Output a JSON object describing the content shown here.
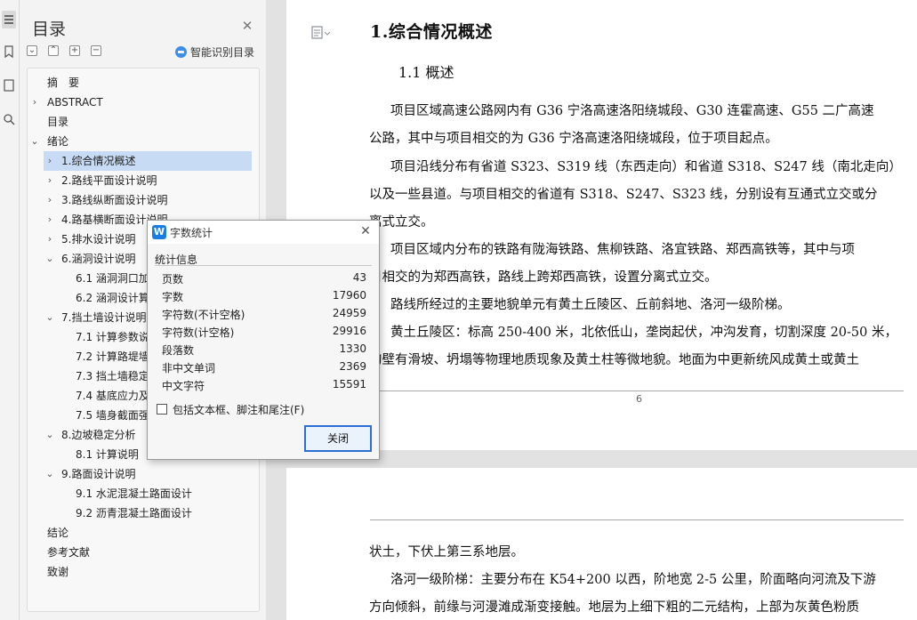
{
  "nav": {
    "title": "目录",
    "smart_label": "智能识别目录",
    "items": [
      {
        "label": "摘　要",
        "caret": ""
      },
      {
        "label": "ABSTRACT",
        "caret": "›"
      },
      {
        "label": "目录",
        "caret": ""
      },
      {
        "label": "绪论",
        "caret": "⌄"
      },
      {
        "label": "1.综合情况概述",
        "caret": "›"
      },
      {
        "label": "2.路线平面设计说明",
        "caret": "›"
      },
      {
        "label": "3.路线纵断面设计说明",
        "caret": "›"
      },
      {
        "label": "4.路基横断面设计说明",
        "caret": "›"
      },
      {
        "label": "5.排水设计说明",
        "caret": "›"
      },
      {
        "label": "6.涵洞设计说明",
        "caret": "⌄"
      },
      {
        "label": "6.1  涵洞洞口加",
        "caret": ""
      },
      {
        "label": "6.2  涵洞设计算",
        "caret": ""
      },
      {
        "label": "7.挡土墙设计说明",
        "caret": "⌄"
      },
      {
        "label": "7.1  计算参数说",
        "caret": ""
      },
      {
        "label": "7.2  计算路堤墙",
        "caret": ""
      },
      {
        "label": "7.3  挡土墙稳定",
        "caret": ""
      },
      {
        "label": "7.4  基底应力及",
        "caret": ""
      },
      {
        "label": "7.5  墙身截面强",
        "caret": ""
      },
      {
        "label": "8.边坡稳定分析",
        "caret": "⌄"
      },
      {
        "label": "8.1 计算说明",
        "caret": ""
      },
      {
        "label": "9.路面设计说明",
        "caret": "⌄"
      },
      {
        "label": "9.1  水泥混凝土路面设计",
        "caret": ""
      },
      {
        "label": "9.2  沥青混凝土路面设计",
        "caret": ""
      },
      {
        "label": "结论",
        "caret": ""
      },
      {
        "label": "参考文献",
        "caret": ""
      },
      {
        "label": "致谢",
        "caret": ""
      }
    ]
  },
  "doc": {
    "heading1": "1.综合情况概述",
    "heading2": "1.1 概述",
    "page1_lines": [
      "项目区域高速公路网内有 G36 宁洛高速洛阳绕城段、G30 连霍高速、G55 二广高速",
      "公路，其中与项目相交的为 G36 宁洛高速洛阳绕城段，位于项目起点。",
      "项目沿线分布有省道 S323、S319 线（东西走向）和省道 S318、S247 线（南北走向）",
      "以及一些县道。与项目相交的省道有 S318、S247、S323 线，分别设有互通式立交或分",
      "离式立交。",
      "项目区域内分布的铁路有陇海铁路、焦柳铁路、洛宜铁路、郑西高铁等，其中与项",
      "目相交的为郑西高铁，路线上跨郑西高铁，设置分离式立交。",
      "路线所经过的主要地貌单元有黄土丘陵区、丘前斜地、洛河一级阶梯。",
      "黄土丘陵区：标高 250-400 米，北依低山，垄岗起伏，冲沟发育，切割深度 20-50 米，",
      "沟壁有滑坡、坍塌等物理地质现象及黄土柱等微地貌。地面为中更新统风成黄土或黄土"
    ],
    "page_number": "6",
    "page2_lines": [
      "状土，下伏上第三系地层。",
      "洛河一级阶梯：主要分布在 K54+200 以西，阶地宽 2-5 公里，阶面略向河流及下游",
      "方向倾斜，前缘与河漫滩成渐变接触。地层为上细下粗的二元结构，上部为灰黄色粉质"
    ]
  },
  "dialog": {
    "title": "字数统计",
    "logo": "W",
    "section": "统计信息",
    "stats": [
      {
        "label": "页数",
        "value": "43"
      },
      {
        "label": "字数",
        "value": "17960"
      },
      {
        "label": "字符数(不计空格)",
        "value": "24959"
      },
      {
        "label": "字符数(计空格)",
        "value": "29916"
      },
      {
        "label": "段落数",
        "value": "1330"
      },
      {
        "label": "非中文单词",
        "value": "2369"
      },
      {
        "label": "中文字符",
        "value": "15591"
      }
    ],
    "include_label": "包括文本框、脚注和尾注(F)",
    "include_checked": false,
    "close_label": "关闭"
  },
  "colors": {
    "selection": "#c7dcf4",
    "accent": "#2b6fd6"
  }
}
